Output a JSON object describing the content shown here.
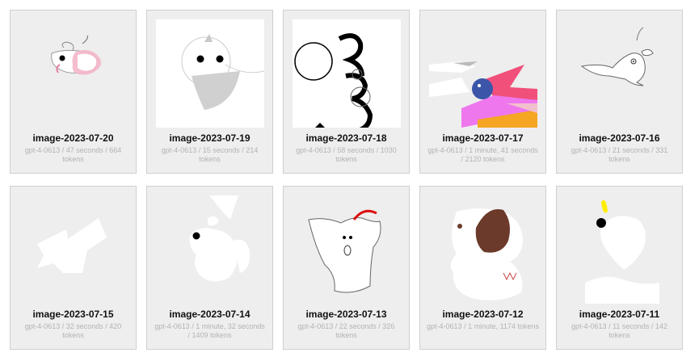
{
  "gallery": {
    "items": [
      {
        "title": "image-2023-07-20",
        "meta": "gpt-4-0613 / 47 seconds / 664 tokens"
      },
      {
        "title": "image-2023-07-19",
        "meta": "gpt-4-0613 / 15 seconds / 214 tokens"
      },
      {
        "title": "image-2023-07-18",
        "meta": "gpt-4-0613 / 58 seconds / 1030 tokens"
      },
      {
        "title": "image-2023-07-17",
        "meta": "gpt-4-0613 / 1 minute, 41 seconds / 2120 tokens"
      },
      {
        "title": "image-2023-07-16",
        "meta": "gpt-4-0613 / 21 seconds / 331 tokens"
      },
      {
        "title": "image-2023-07-15",
        "meta": "gpt-4-0613 / 32 seconds / 420 tokens"
      },
      {
        "title": "image-2023-07-14",
        "meta": "gpt-4-0613 / 1 minute, 32 seconds / 1409 tokens"
      },
      {
        "title": "image-2023-07-13",
        "meta": "gpt-4-0613 / 22 seconds / 326 tokens"
      },
      {
        "title": "image-2023-07-12",
        "meta": "gpt-4-0613 / 1 minute, 1174 tokens"
      },
      {
        "title": "image-2023-07-11",
        "meta": "gpt-4-0613 / 11 seconds / 142 tokens"
      }
    ]
  }
}
